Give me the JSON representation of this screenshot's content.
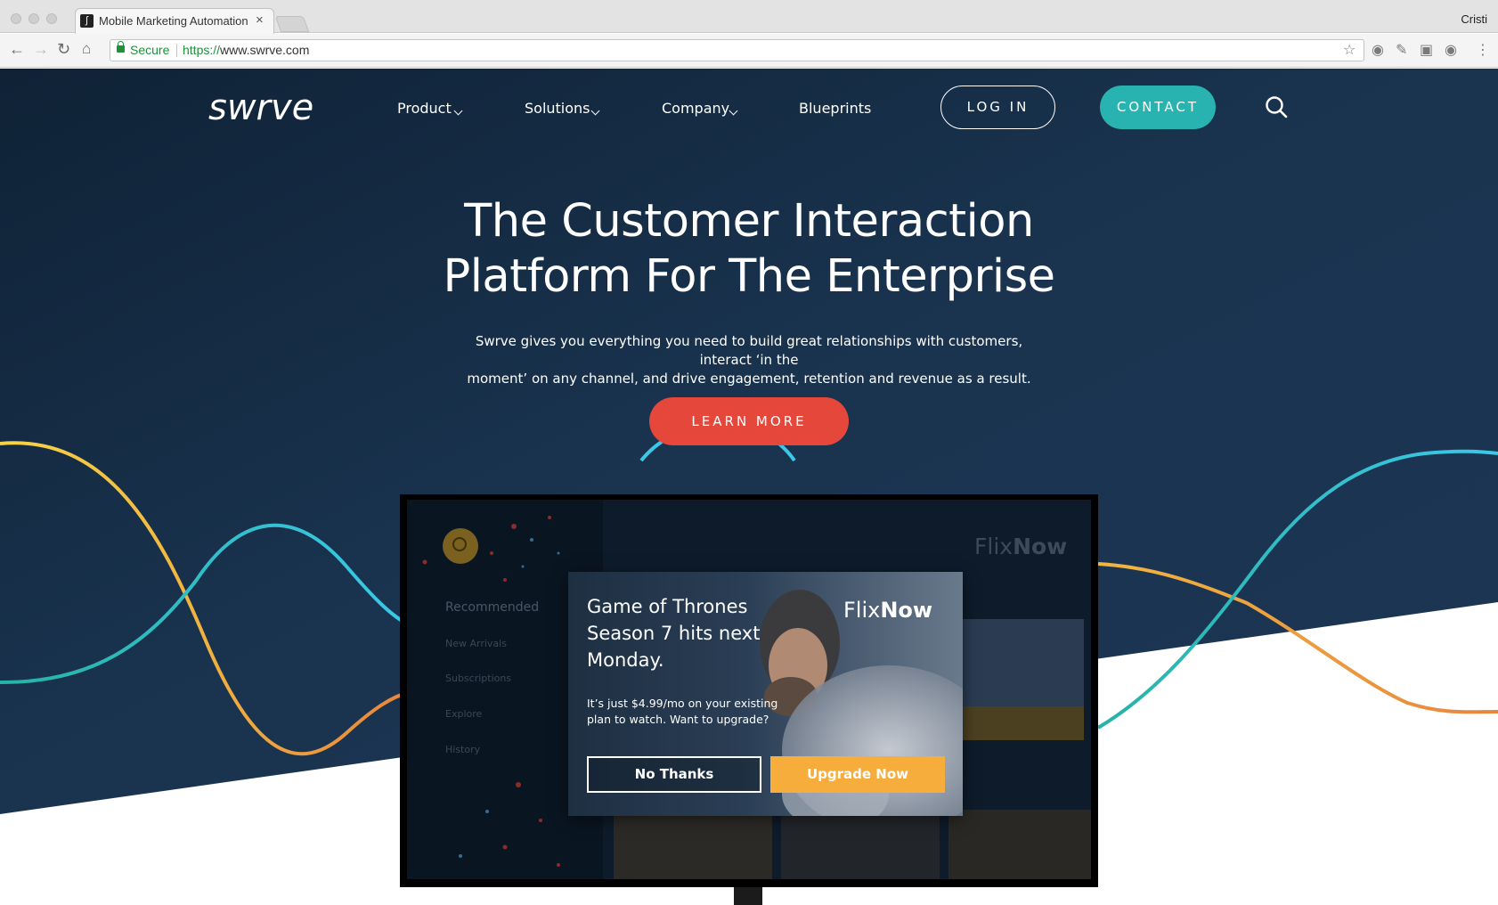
{
  "browser": {
    "tab_title": "Mobile Marketing Automation,",
    "tab_close": "×",
    "profile_name": "Cristi",
    "secure_label": "Secure",
    "url_scheme": "https://",
    "url_host": "www.swrve.com"
  },
  "header": {
    "logo_text": "swrve",
    "nav": [
      {
        "label": "Product",
        "has_dropdown": true
      },
      {
        "label": "Solutions",
        "has_dropdown": true
      },
      {
        "label": "Company",
        "has_dropdown": true
      },
      {
        "label": "Blueprints",
        "has_dropdown": false
      }
    ],
    "login_label": "LOG IN",
    "contact_label": "CONTACT"
  },
  "hero": {
    "title_line1": "The Customer Interaction",
    "title_line2": "Platform For The Enterprise",
    "subtitle_line1": "Swrve gives you everything you need to build great relationships with customers, interact ‘in the",
    "subtitle_line2": "moment’ on any channel, and drive engagement, retention and revenue as a result.",
    "cta_label": "LEARN MORE"
  },
  "tv": {
    "brand_prefix": "Flix",
    "brand_suffix": "Now",
    "menu": [
      "Recommended",
      "New Arrivals",
      "Subscriptions",
      "Explore",
      "History"
    ]
  },
  "popup": {
    "headline_line1": "Game of Thrones",
    "headline_line2": "Season 7 hits next",
    "headline_line3": "Monday.",
    "body": "It’s just $4.99/mo on your existing plan to watch. Want to upgrade?",
    "brand_prefix": "Flix",
    "brand_suffix": "Now",
    "decline_label": "No Thanks",
    "accept_label": "Upgrade Now"
  },
  "colors": {
    "hero_dark": "#1a3450",
    "hero_deep": "#0f2236",
    "contact_teal": "#28b3b0",
    "learn_red": "#e5473b",
    "upgrade_orange": "#f7ad3b",
    "wave_yellow": "#f6d548",
    "wave_cyan": "#3cc8e8",
    "wave_orange": "#e8853c"
  },
  "icons": {
    "back": "arrow-left-icon",
    "forward": "arrow-right-icon",
    "reload": "reload-icon",
    "home": "home-icon",
    "star": "star-icon",
    "pocket": "pocket-icon",
    "pen": "pen-icon",
    "screenshot": "screenshot-icon",
    "camera": "camera-icon",
    "menu": "kebab-menu-icon",
    "search": "search-icon"
  }
}
